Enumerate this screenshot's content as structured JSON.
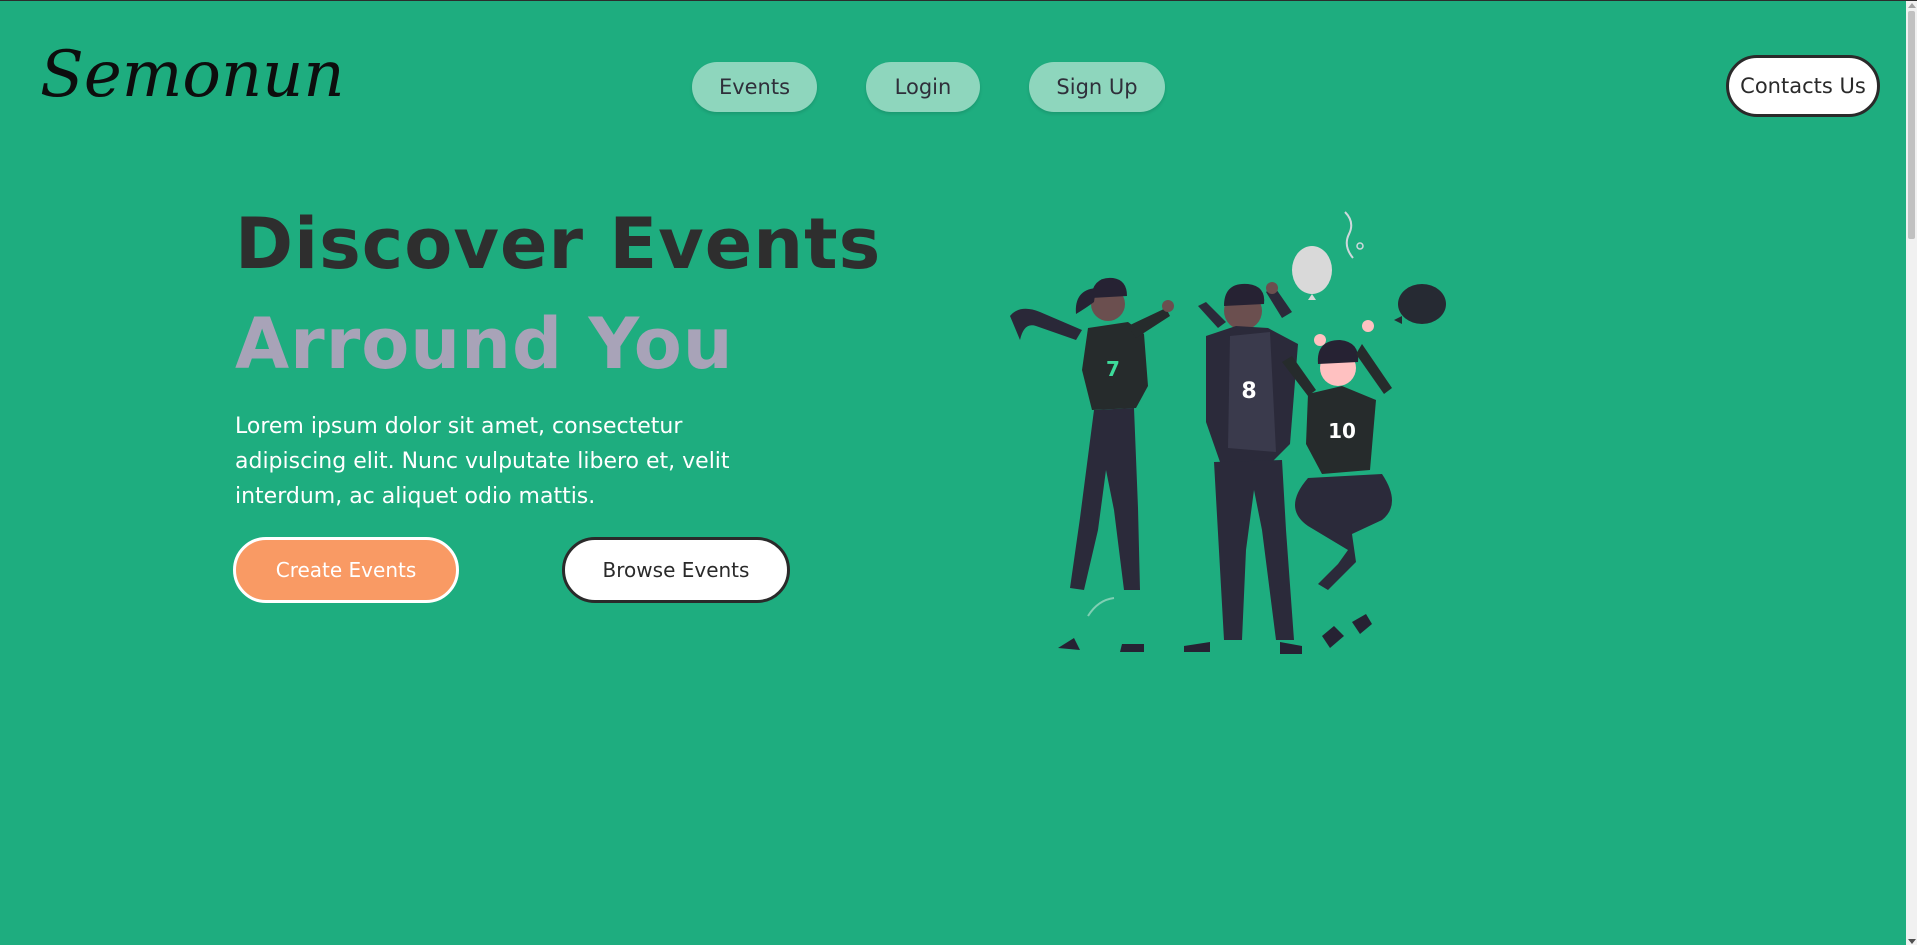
{
  "brand": {
    "logo_text": "Semonun"
  },
  "nav": {
    "items": [
      {
        "label": "Events"
      },
      {
        "label": "Login"
      },
      {
        "label": "Sign Up"
      }
    ],
    "contact_label": "Contacts Us"
  },
  "hero": {
    "title_line1": "Discover Events",
    "title_line2": "Arround You",
    "description": "Lorem ipsum dolor sit amet, consectetur adipiscing elit. Nunc vulputate libero et, velit interdum, ac aliquet odio mattis.",
    "create_label": "Create Events",
    "browse_label": "Browse Events"
  },
  "illustration": {
    "jersey_numbers": [
      "7",
      "8",
      "10"
    ]
  },
  "colors": {
    "background": "#1ead7f",
    "nav_pill": "#8ed6bd",
    "title_dark": "#2e2e2e",
    "title_light": "#a8a3b8",
    "accent_orange": "#f99a64"
  }
}
